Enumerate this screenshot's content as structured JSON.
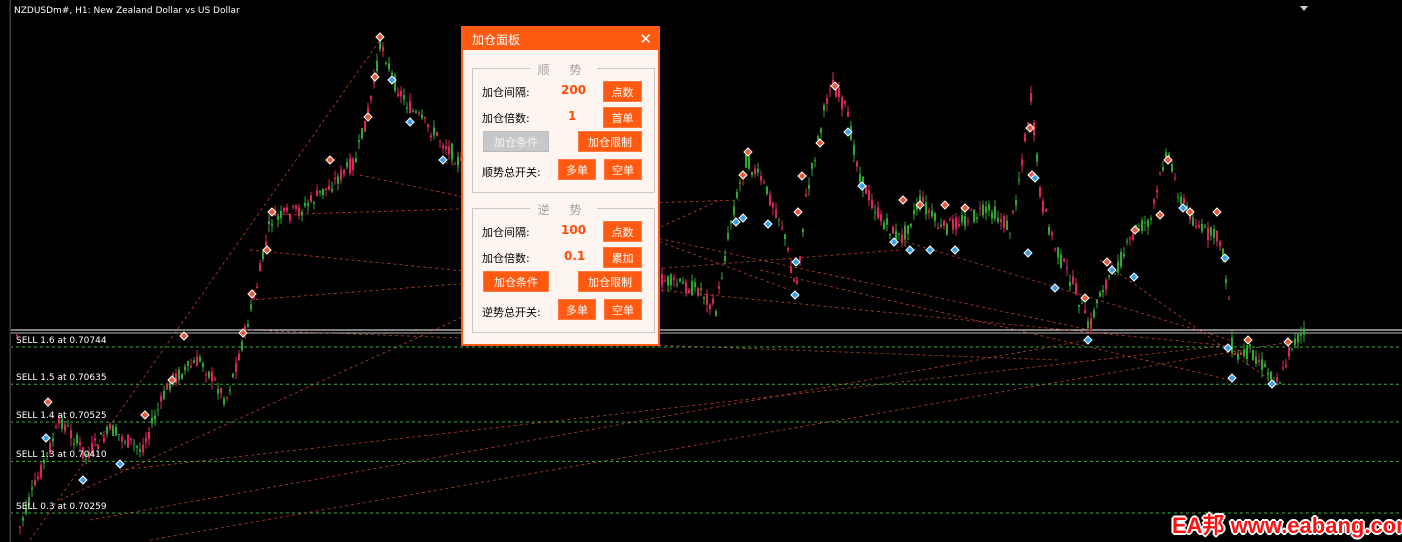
{
  "chart": {
    "symbol_title": "NZDUSDm#, H1:  New Zealand Dollar vs US Dollar",
    "up_color": "#2fa82f",
    "down_color": "#e0245a",
    "grid_line_color": "#3fae3f",
    "order_lines": [
      {
        "label": "SELL 1.6 at 0.70744",
        "price": 0.70744
      },
      {
        "label": "SELL 1.5 at 0.70635",
        "price": 0.70635
      },
      {
        "label": "SELL 1.4 at 0.70525",
        "price": 0.70525
      },
      {
        "label": "SELL 1.3 at 0.70410",
        "price": 0.7041
      },
      {
        "label": "SELL 0.3 at 0.70259",
        "price": 0.70259
      }
    ]
  },
  "panel": {
    "title": "加仓面板",
    "close_glyph": "✕",
    "trend": {
      "title": "顺 势",
      "interval_label": "加仓间隔:",
      "interval_value": "200",
      "interval_btn": "点数",
      "multiple_label": "加仓倍数:",
      "multiple_value": "1",
      "multiple_btn": "首单",
      "cond_btn": "加仓条件",
      "limit_btn": "加仓限制",
      "switch_label": "顺势总开关:",
      "buy_btn": "多单",
      "sell_btn": "空单"
    },
    "counter": {
      "title": "逆 势",
      "interval_label": "加仓间隔:",
      "interval_value": "100",
      "interval_btn": "点数",
      "multiple_label": "加仓倍数:",
      "multiple_value": "0.1",
      "multiple_btn": "累加",
      "cond_btn": "加仓条件",
      "limit_btn": "加仓限制",
      "switch_label": "逆势总开关:",
      "buy_btn": "多单",
      "sell_btn": "空单"
    }
  },
  "watermark": "EA邦 www.eabang.com"
}
